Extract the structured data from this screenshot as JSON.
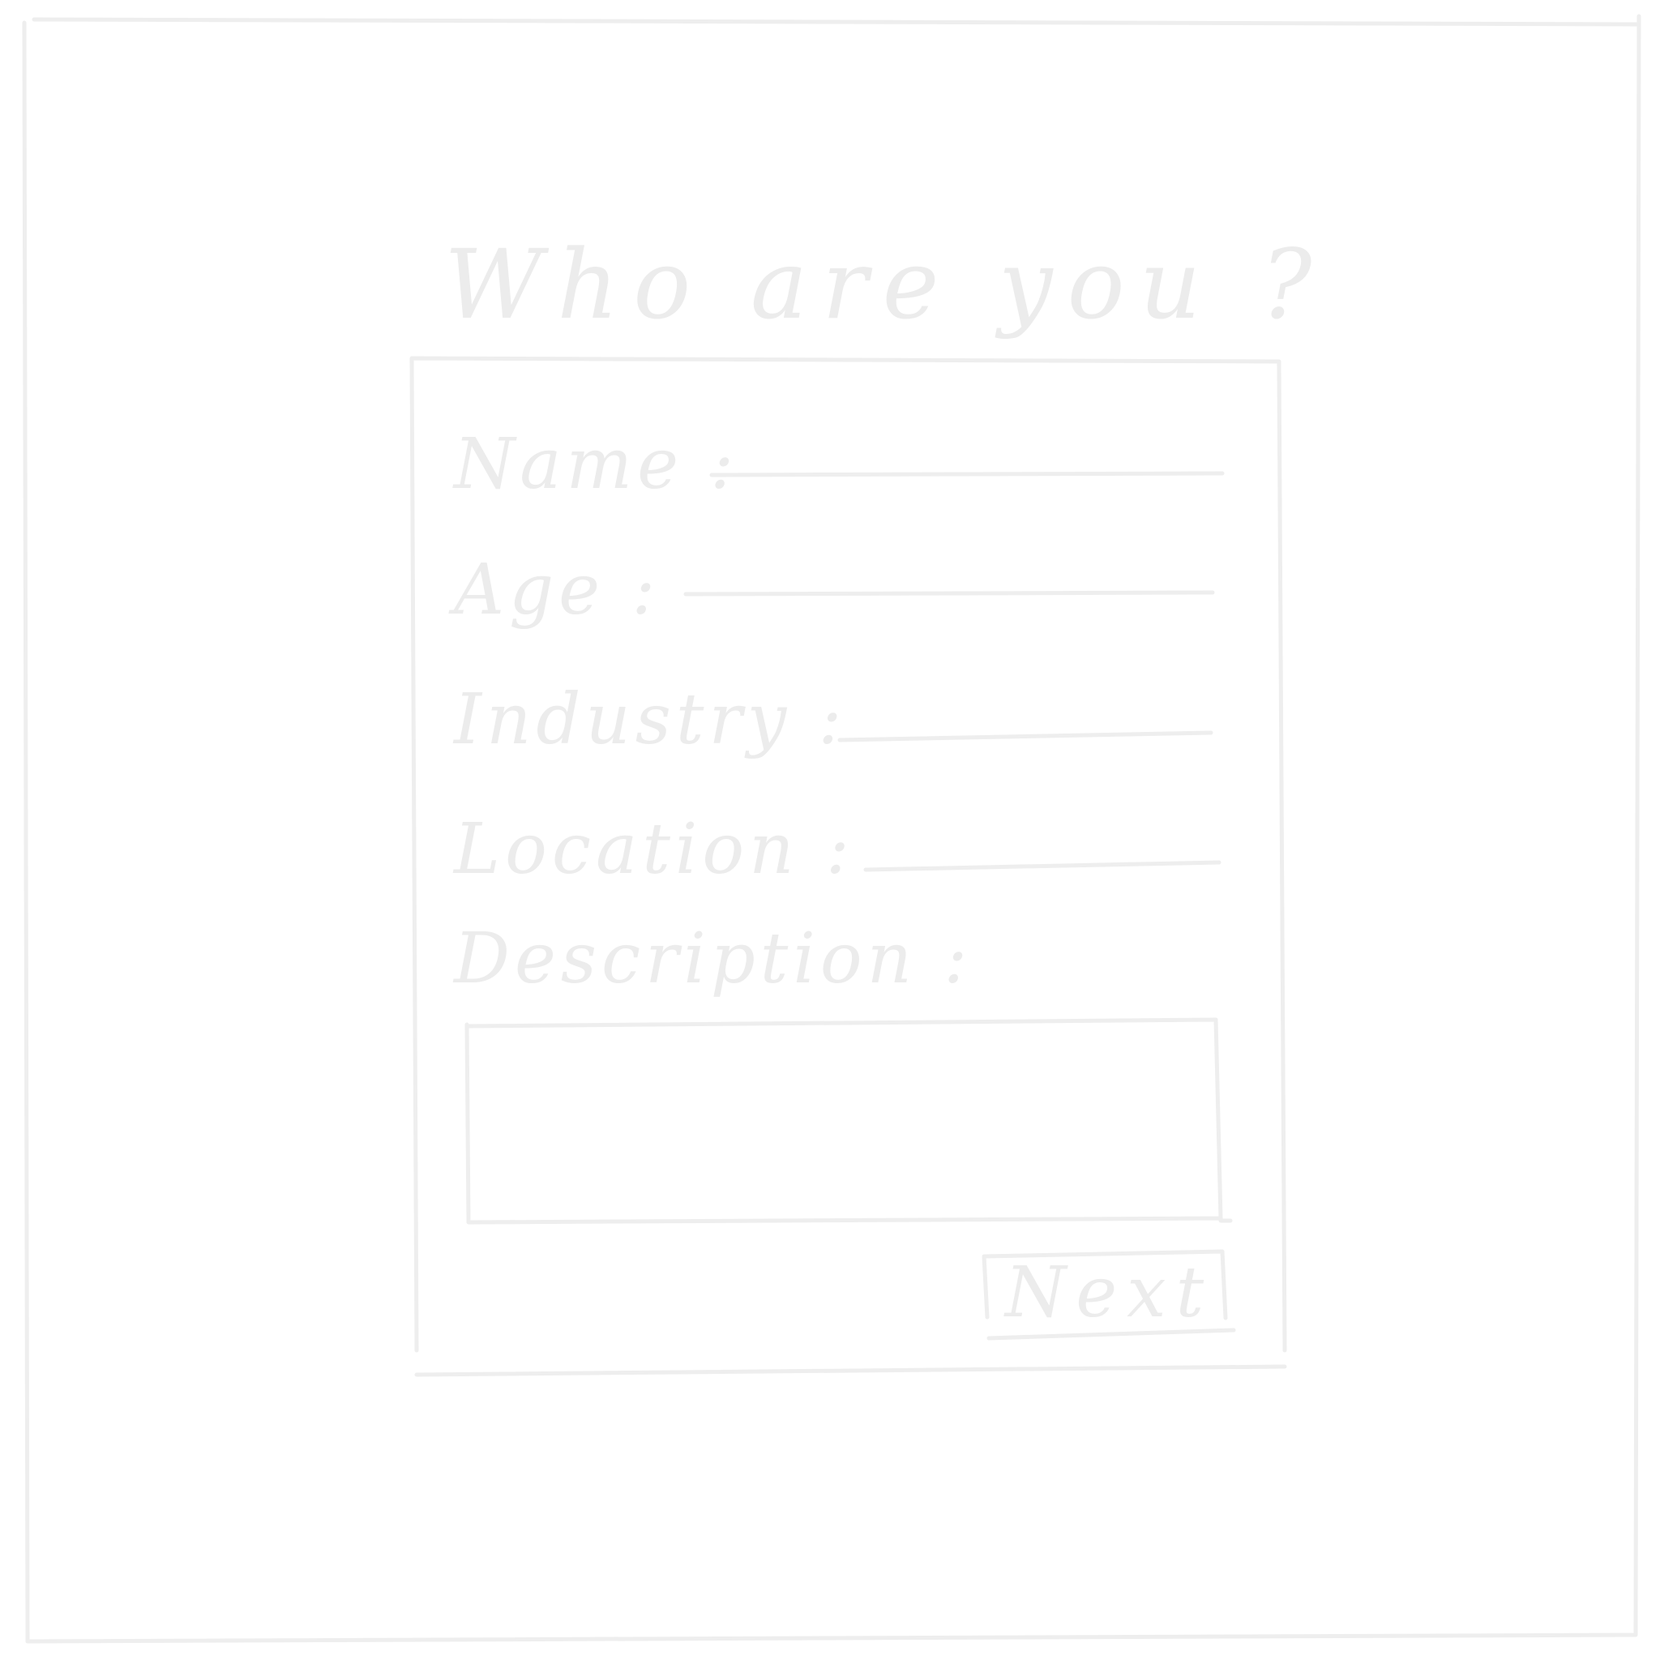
{
  "form": {
    "title": "Who are you ?",
    "fields": {
      "name_label": "Name :",
      "age_label": "Age :",
      "industry_label": "Industry :",
      "location_label": "Location :",
      "description_label": "Description :"
    },
    "next_label": "Next"
  },
  "colors": {
    "stroke": "#eeeeee",
    "background": "#ffffff"
  }
}
